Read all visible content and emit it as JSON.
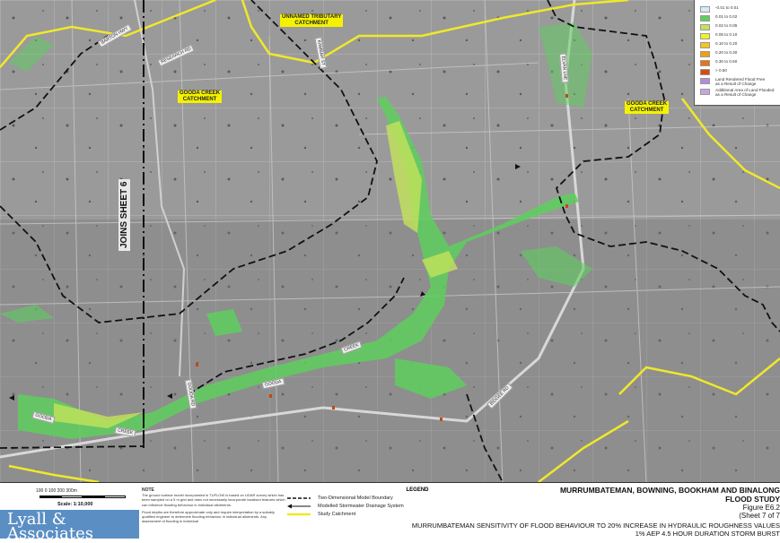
{
  "map": {
    "catchment_labels": [
      "UNNAMED TRIBUTARY\nCATCHMENT",
      "GOODA CREEK\nCATCHMENT",
      "GOODA CREEK\nCATCHMENT"
    ],
    "road_labels": [
      "RESEARCH RD",
      "BARTON HWY",
      "KAMBAH ST",
      "ELVAN LNE",
      "GOODA RD",
      "GOODA",
      "CREEK",
      "GOODA",
      "CREEK",
      "BIDGEE RD"
    ],
    "joins_sheet": "JOINS SHEET 6"
  },
  "legend_box": {
    "items": [
      {
        "label": "-0.01 to 0.01",
        "color": "#d4ecf7"
      },
      {
        "label": "0.01 to 0.02",
        "color": "#5ecf5e"
      },
      {
        "label": "0.02 to 0.05",
        "color": "#c3e35a"
      },
      {
        "label": "0.05 to 0.10",
        "color": "#f2f030"
      },
      {
        "label": "0.10 to 0.20",
        "color": "#f5c518"
      },
      {
        "label": "0.20 to 0.30",
        "color": "#f0a010"
      },
      {
        "label": "0.30 to 0.50",
        "color": "#e87412"
      },
      {
        "label": "> 0.50",
        "color": "#d9480f"
      },
      {
        "label": "Land Rendered Flood Free\nas a Result of Change",
        "color": "#b58be0"
      },
      {
        "label": "Additional Area of Land Flooded\nas a Result of Change",
        "color": "#c9a6d9"
      }
    ]
  },
  "footer": {
    "scale_ticks": "100    0    100    200    300m",
    "scale_label": "Scale: 1:10,000",
    "logo_text": "Lyall &\nAssociates",
    "note_title": "NOTE",
    "note_text_1": "The ground surface model incorporated in TUFLOW is based on LiDAR survey which has been sampled on a 5 m grid and does not necessarily incorporate localised features which can influence flooding behaviour in individual allotments.",
    "note_text_2": "Flood depths are therefore approximate only and require interpretation by a suitably qualified engineer to determine flooding behaviour in individual allotments. Any assessment of flooding in individual",
    "legend_title": "LEGEND",
    "legend_items": [
      {
        "label": "Two-Dimensional Model Boundary"
      },
      {
        "label": "Modelled Stormwater Drainage System"
      },
      {
        "label": "Study Catchment"
      }
    ],
    "title_1": "MURRUMBATEMAN, BOWNING, BOOKHAM AND BINALONG",
    "title_2": "FLOOD STUDY",
    "figure": "Figure E6.2",
    "sheet": "(Sheet 7 of 7",
    "subtitle_1": "MURRUMBATEMAN SENSITIVITY OF FLOOD BEHAVIOUR TO 20% INCREASE IN HYDRAULIC ROUGHNESS VALUES",
    "subtitle_2": "1% AEP  4.5 HOUR DURATION  STORM BURST"
  }
}
